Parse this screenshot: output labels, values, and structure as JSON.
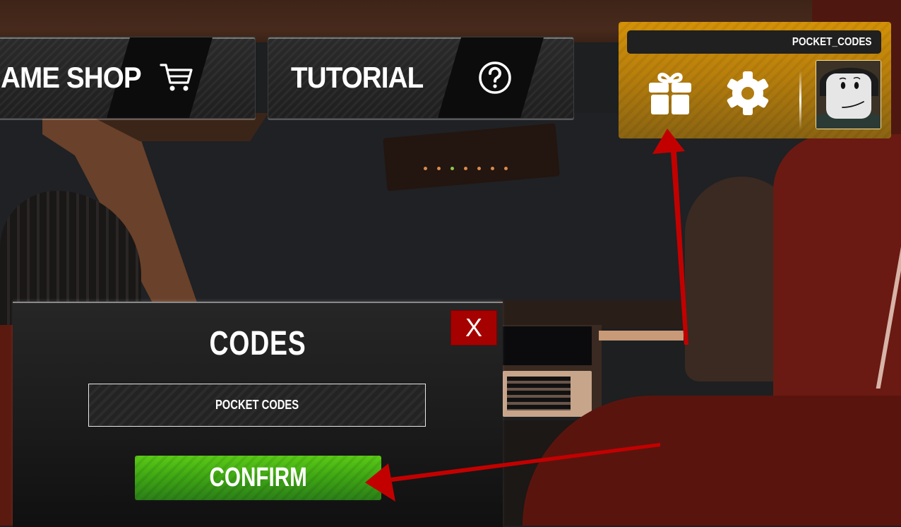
{
  "nav": {
    "shop": {
      "label": "AME SHOP",
      "icon": "shopping-cart-icon"
    },
    "tutorial": {
      "label": "TUTORIAL",
      "icon": "question-circle-icon"
    }
  },
  "profile": {
    "username": "POCKET_CODES",
    "gift_icon": "gift-icon",
    "settings_icon": "gear-icon",
    "avatar": "avatar"
  },
  "codes_modal": {
    "title": "CODES",
    "close_label": "X",
    "input_value": "POCKET CODES",
    "confirm_label": "CONFIRM"
  },
  "annotations": {
    "arrow_to_gift": "red-arrow-pointing-gift",
    "arrow_to_confirm": "red-arrow-pointing-confirm"
  },
  "colors": {
    "profile_gold": "#c98a0a",
    "close_red": "#a50100",
    "confirm_green": "#3ea514",
    "arrow_red": "#c30000"
  }
}
